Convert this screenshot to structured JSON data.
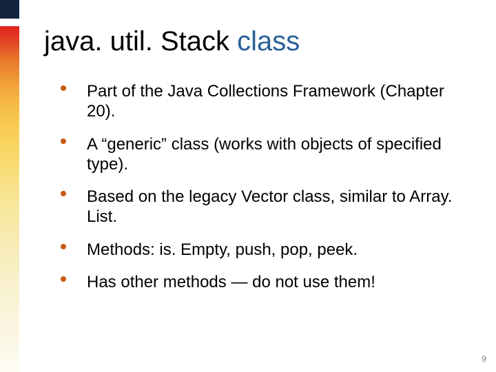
{
  "title": {
    "prefix": "java. util. Stack ",
    "highlight": "class"
  },
  "bullets": [
    "Part of the Java Collections Framework (Chapter 20).",
    "A “generic” class (works with objects of specified type).",
    "Based on the legacy Vector class, similar to Array. List.",
    "Methods: is. Empty, push, pop, peek.",
    "Has other methods — do not use them!"
  ],
  "slide_number": "9"
}
